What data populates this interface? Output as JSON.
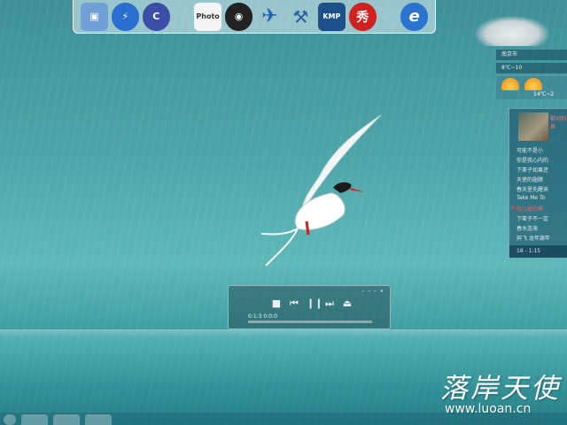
{
  "dock": {
    "icons": [
      {
        "name": "my-computer",
        "glyph": "▣",
        "color": "#6fa0d8"
      },
      {
        "name": "thunder",
        "glyph": "⚡",
        "color": "#2a6fd0"
      },
      {
        "name": "cc",
        "glyph": "C",
        "color": "#3b4ea8"
      },
      {
        "name": "photo",
        "glyph": "Photo",
        "color": "#f4f4f4"
      },
      {
        "name": "qq",
        "glyph": "◉",
        "color": "#222222"
      },
      {
        "name": "plane",
        "glyph": "✈",
        "color": "#3a7bd5"
      },
      {
        "name": "tool",
        "glyph": "⚒",
        "color": "#5080c0"
      },
      {
        "name": "kmp",
        "glyph": "KMP",
        "color": "#1d4f8a"
      },
      {
        "name": "xiu",
        "glyph": "秀",
        "color": "#d02020"
      },
      {
        "name": "ie",
        "glyph": "e",
        "color": "#2a74d0"
      }
    ]
  },
  "weather": {
    "line1": "南京市",
    "line2": "8℃~10",
    "temp": "14℃~2"
  },
  "music": {
    "title": "歌词列表",
    "tracks": [
      "可能不是小",
      "你是我心内的",
      "下辈子如果还",
      "天使的翅膀",
      "春天里先醒来",
      "Take Me To",
      "花儿纳尔蒂",
      "下辈子不一定",
      "春水连海",
      "异飞 龙年谢年"
    ],
    "active_index": 6,
    "footer": "18  -  1:15"
  },
  "player": {
    "title": "- - - •",
    "time": "0:1:3 0:0:0"
  },
  "watermark": {
    "chinese": "落岸天使",
    "url": "www.luoan.cn"
  }
}
